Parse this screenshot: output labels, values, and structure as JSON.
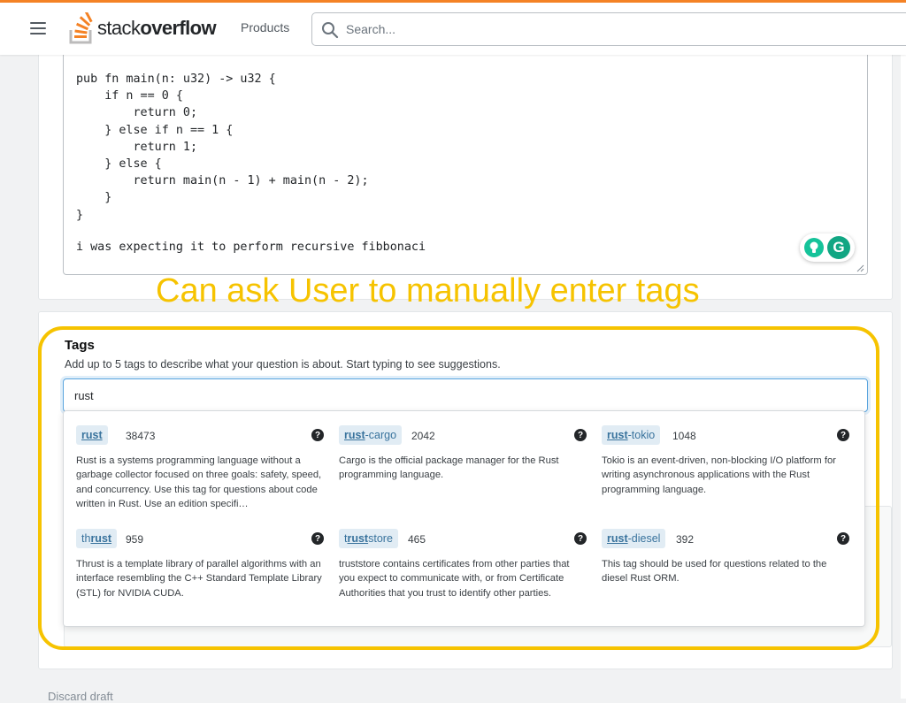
{
  "header": {
    "logo_text_a": "stack",
    "logo_text_b": "overflow",
    "products_label": "Products",
    "search_placeholder": "Search..."
  },
  "editor": {
    "code": "pub fn main(n: u32) -> u32 {\n    if n == 0 {\n        return 0;\n    } else if n == 1 {\n        return 1;\n    } else {\n        return main(n - 1) + main(n - 2);\n    }\n}",
    "note": "i was expecting it to perform recursive fibbonaci",
    "grammarly_letter": "G"
  },
  "annotation": "Can ask User to manually enter tags",
  "tags": {
    "title": "Tags",
    "description": "Add up to 5 tags to describe what your question is about. Start typing to see suggestions.",
    "input_value": "rust",
    "help_symbol": "?",
    "suggestions": [
      {
        "pre": "",
        "match": "rust",
        "post": "",
        "count": "38473",
        "desc": "Rust is a systems programming language without a garbage collector focused on three goals: safety, speed, and concurrency. Use this tag for questions about code written in Rust. Use an edition specifi…"
      },
      {
        "pre": "",
        "match": "rust",
        "post": "-cargo",
        "count": "2042",
        "desc": "Cargo is the official package manager for the Rust programming language."
      },
      {
        "pre": "",
        "match": "rust",
        "post": "-tokio",
        "count": "1048",
        "desc": "Tokio is an event-driven, non-blocking I/O platform for writing asynchronous applications with the Rust programming language."
      },
      {
        "pre": "th",
        "match": "rust",
        "post": "",
        "count": "959",
        "desc": "Thrust is a template library of parallel algorithms with an interface resembling the C++ Standard Template Library (STL) for NVIDIA CUDA."
      },
      {
        "pre": "t",
        "match": "rust",
        "post": "store",
        "count": "465",
        "desc": "truststore contains certificates from other parties that you expect to communicate with, or from Certificate Authorities that you trust to identify other parties."
      },
      {
        "pre": "",
        "match": "rust",
        "post": "-diesel",
        "count": "392",
        "desc": "This tag should be used for questions related to the diesel Rust ORM."
      }
    ]
  },
  "footer_peek": "Discard draft",
  "colors": {
    "brand_orange": "#f48225",
    "annotation_yellow": "#f6c300",
    "tag_bg": "#e1ecf4",
    "tag_text": "#39739d"
  }
}
